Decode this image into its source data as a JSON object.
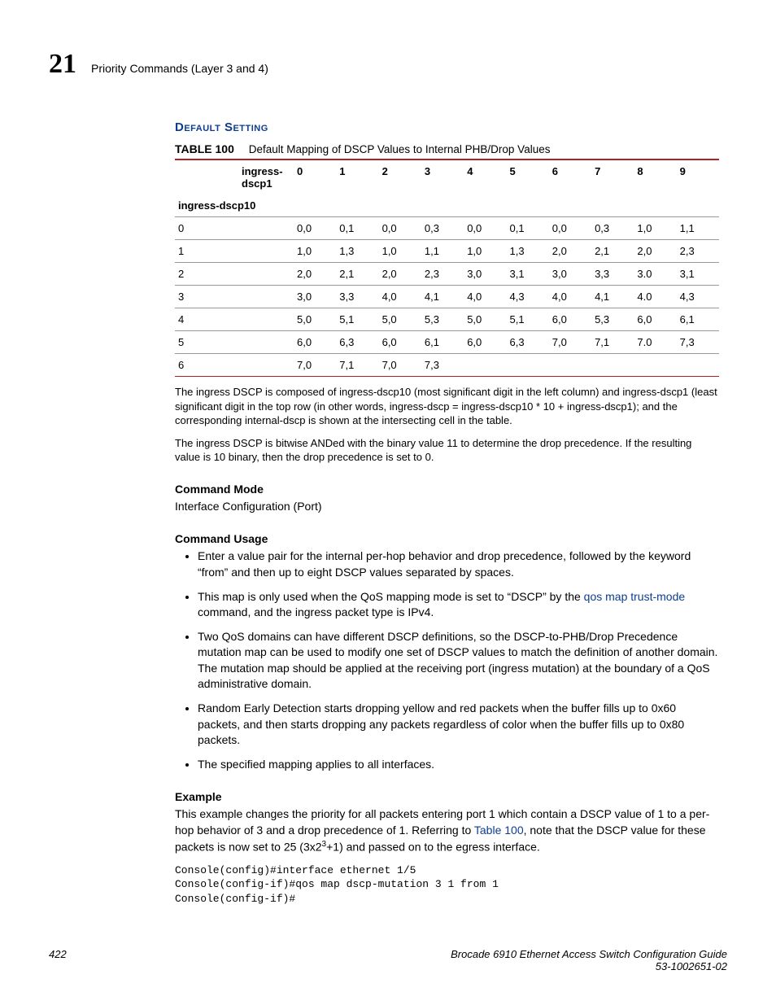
{
  "header": {
    "chapter_number": "21",
    "chapter_title": "Priority Commands (Layer 3 and 4)"
  },
  "section_heading": "Default Setting",
  "table": {
    "label": "TABLE 100",
    "title": "Default Mapping of DSCP Values to Internal PHB/Drop Values",
    "col_axis_label": "ingress-dscp1",
    "row_axis_label": "ingress-dscp10",
    "col_headers": [
      "0",
      "1",
      "2",
      "3",
      "4",
      "5",
      "6",
      "7",
      "8",
      "9"
    ],
    "rows": [
      {
        "h": "0",
        "cells": [
          "0,0",
          "0,1",
          "0,0",
          "0,3",
          "0,0",
          "0,1",
          "0,0",
          "0,3",
          "1,0",
          "1,1"
        ]
      },
      {
        "h": "1",
        "cells": [
          "1,0",
          "1,3",
          "1,0",
          "1,1",
          "1,0",
          "1,3",
          "2,0",
          "2,1",
          "2,0",
          "2,3"
        ]
      },
      {
        "h": "2",
        "cells": [
          "2,0",
          "2,1",
          "2,0",
          "2,3",
          "3,0",
          "3,1",
          "3,0",
          "3,3",
          "3.0",
          "3,1"
        ]
      },
      {
        "h": "3",
        "cells": [
          "3,0",
          "3,3",
          "4,0",
          "4,1",
          "4,0",
          "4,3",
          "4,0",
          "4,1",
          "4.0",
          "4,3"
        ]
      },
      {
        "h": "4",
        "cells": [
          "5,0",
          "5,1",
          "5,0",
          "5,3",
          "5,0",
          "5,1",
          "6,0",
          "5,3",
          "6,0",
          "6,1"
        ]
      },
      {
        "h": "5",
        "cells": [
          "6,0",
          "6,3",
          "6,0",
          "6,1",
          "6,0",
          "6,3",
          "7,0",
          "7,1",
          "7.0",
          "7,3"
        ]
      },
      {
        "h": "6",
        "cells": [
          "7,0",
          "7,1",
          "7,0",
          "7,3",
          "",
          "",
          "",
          "",
          "",
          ""
        ]
      }
    ]
  },
  "notes": {
    "n1": "The ingress DSCP is composed of ingress-dscp10 (most significant digit in the left column) and ingress-dscp1 (least significant digit in the top row (in other words, ingress-dscp = ingress-dscp10 * 10 + ingress-dscp1); and the corresponding internal-dscp is shown at the intersecting cell in the table.",
    "n2": "The ingress DSCP is bitwise ANDed with the binary value 11 to determine the drop precedence. If the resulting value is 10 binary, then the drop precedence is set to 0."
  },
  "command_mode": {
    "heading": "Command Mode",
    "text": "Interface Configuration (Port)"
  },
  "command_usage": {
    "heading": "Command Usage",
    "bullets": [
      "Enter a value pair for the internal per-hop behavior and drop precedence, followed by the keyword “from” and then up to eight DSCP values separated by spaces.",
      "",
      "Two QoS domains can have different DSCP definitions, so the DSCP-to-PHB/Drop Precedence mutation map can be used to modify one set of DSCP values to match the definition of another domain. The mutation map should be applied at the receiving port (ingress mutation) at the boundary of a QoS administrative domain.",
      "Random Early Detection starts dropping yellow and red packets when the buffer fills up to 0x60 packets, and then starts dropping any packets regardless of color when the buffer fills up to 0x80 packets.",
      "The specified mapping applies to all interfaces."
    ],
    "bullet2_pre": "This map is only used when the QoS mapping mode is set to “DSCP” by the ",
    "bullet2_link": "qos map trust-mode",
    "bullet2_post": " command, and the ingress packet type is IPv4."
  },
  "example": {
    "heading": "Example",
    "p_pre": "This example changes the priority for all packets entering port 1 which contain a DSCP value of 1 to a per-hop behavior of 3 and a drop precedence of 1. Referring to ",
    "p_link": "Table 100",
    "p_mid": ", note that the DSCP value for these packets is now set to 25 (3x2",
    "p_sup": "3",
    "p_post": "+1) and passed on to the egress interface.",
    "console": "Console(config)#interface ethernet 1/5\nConsole(config-if)#qos map dscp-mutation 3 1 from 1\nConsole(config-if)#"
  },
  "footer": {
    "page": "422",
    "doc_title": "Brocade 6910 Ethernet Access Switch Configuration Guide",
    "doc_id": "53-1002651-02"
  }
}
